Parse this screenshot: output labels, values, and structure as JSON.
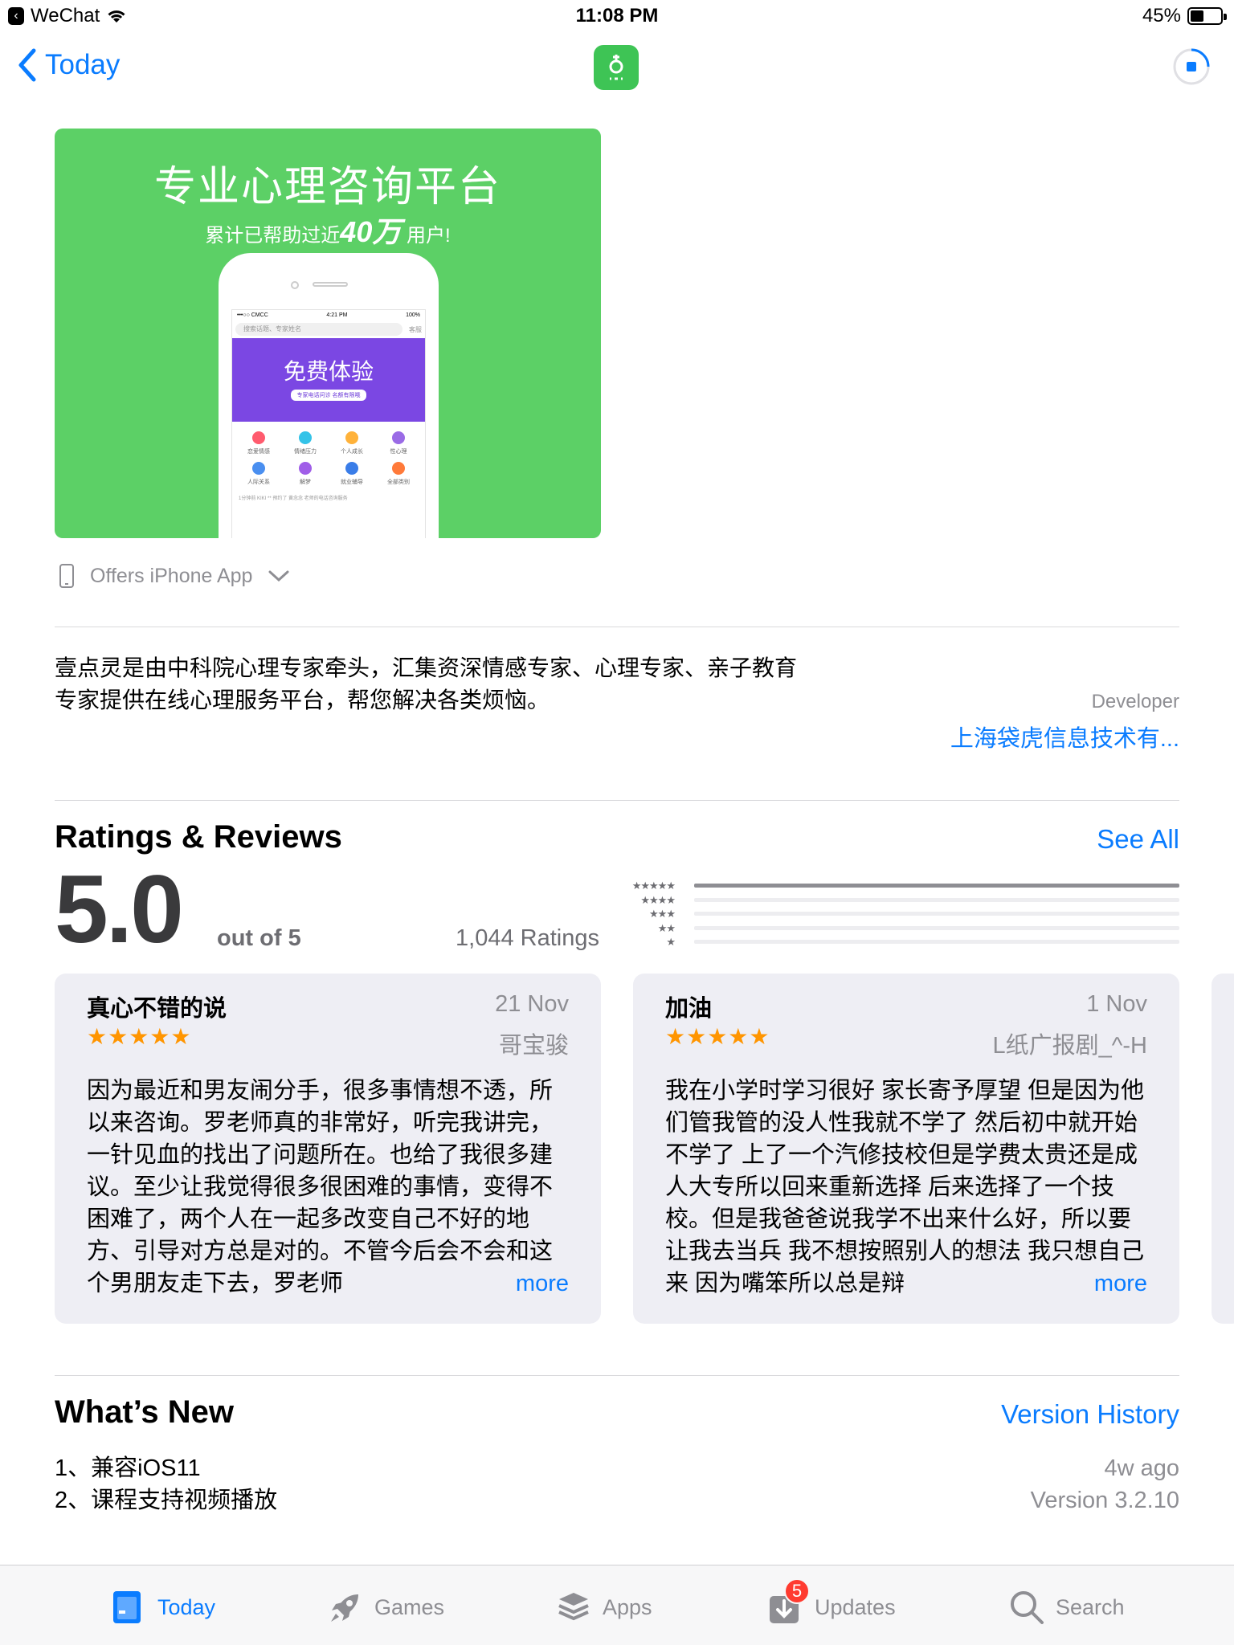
{
  "status_bar": {
    "back_app": "WeChat",
    "time": "11:08 PM",
    "battery_percent_label": "45%",
    "battery_level": 0.45
  },
  "nav": {
    "back_label": "Today",
    "accent_color": "#0a7cff"
  },
  "screenshot": {
    "title": "专业心理咨询平台",
    "subtitle_prefix": "累计已帮助过近",
    "subtitle_number": "40万",
    "subtitle_suffix": "用户!",
    "phone_status_carrier": "•••○○ CMCC",
    "phone_status_time": "4:21 PM",
    "phone_status_battery": "100%",
    "phone_search_placeholder": "搜索话题、专家姓名",
    "phone_service": "客服",
    "banner_title": "免费体验",
    "banner_pill": "专家电话问诊 名额有限哦",
    "grid_items": [
      "恋爱情感",
      "情绪压力",
      "个人成长",
      "性心理",
      "人际关系",
      "解梦",
      "就业辅导",
      "全部类别"
    ],
    "footer_text": "1分钟前 KIKI ** 预约了 黄念念 老师的电话咨询服务"
  },
  "offers": {
    "label": "Offers iPhone App"
  },
  "description": {
    "line1": "壹点灵是由中科院心理专家牵头，汇集资深情感专家、心理专家、亲子教育",
    "line2": "专家提供在线心理服务平台，帮您解决各类烦恼。",
    "developer_label": "Developer",
    "developer_name": "上海袋虎信息技术有..."
  },
  "ratings": {
    "title": "Ratings & Reviews",
    "see_all": "See All",
    "score": "5.0",
    "out_of": "out of 5",
    "count": "1,044 Ratings",
    "histogram": [
      {
        "stars": "★★★★★",
        "fraction": 1.0
      },
      {
        "stars": "★★★★",
        "fraction": 0.0
      },
      {
        "stars": "★★★",
        "fraction": 0.0
      },
      {
        "stars": "★★",
        "fraction": 0.0
      },
      {
        "stars": "★",
        "fraction": 0.0
      }
    ]
  },
  "reviews": [
    {
      "title": "真心不错的说",
      "date": "21 Nov",
      "stars": "★★★★★",
      "author": "哥宝骏",
      "body": "因为最近和男友闹分手，很多事情想不透，所以来咨询。罗老师真的非常好，听完我讲完，一针见血的找出了问题所在。也给了我很多建议。至少让我觉得很多很困难的事情，变得不困难了，两个人在一起多改变自己不好的地方、引导对方总是对的。不管今后会不会和这个男朋友走下去，罗老师",
      "more": "more"
    },
    {
      "title": "加油",
      "date": "1 Nov",
      "stars": "★★★★★",
      "author": "L纸广报剧_^-H",
      "body": "我在小学时学习很好 家长寄予厚望 但是因为他们管我管的没人性我就不学了 然后初中就开始不学了 上了一个汽修技校但是学费太贵还是成人大专所以回来重新选择 后来选择了一个技校。但是我爸爸说我学不出来什么好，所以要让我去当兵 我不想按照别人的想法 我只想自己来 因为嘴笨所以总是辩",
      "more": "more"
    }
  ],
  "whats_new": {
    "title": "What’s New",
    "version_history": "Version History",
    "lines": [
      "1、兼容iOS11",
      "2、课程支持视频播放"
    ],
    "age": "4w ago",
    "version": "Version 3.2.10"
  },
  "tab_bar": {
    "items": [
      {
        "label": "Today",
        "icon": "today-icon"
      },
      {
        "label": "Games",
        "icon": "rocket-icon"
      },
      {
        "label": "Apps",
        "icon": "stack-icon"
      },
      {
        "label": "Updates",
        "icon": "download-icon"
      },
      {
        "label": "Search",
        "icon": "search-icon"
      }
    ],
    "updates_badge": "5",
    "active": "Today"
  }
}
